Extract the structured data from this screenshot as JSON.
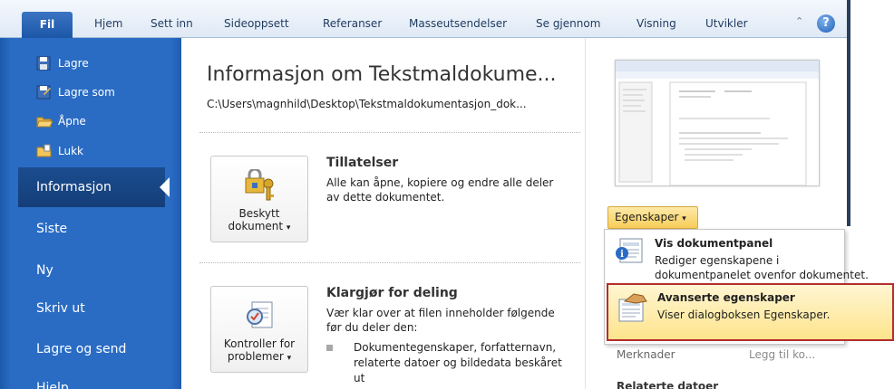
{
  "ribbon": {
    "file_tab": "Fil",
    "tabs": [
      "Hjem",
      "Sett inn",
      "Sideoppsett",
      "Referanser",
      "Masseutsendelser",
      "Se gjennom",
      "Visning",
      "Utvikler"
    ],
    "help_glyph": "?",
    "collapse_glyph": "⌃"
  },
  "nav": {
    "commands": [
      {
        "label": "Lagre",
        "icon": "save-icon"
      },
      {
        "label": "Lagre som",
        "icon": "save-as-icon"
      },
      {
        "label": "Åpne",
        "icon": "open-folder-icon"
      },
      {
        "label": "Lukk",
        "icon": "close-folder-icon"
      }
    ],
    "items": [
      "Informasjon",
      "Siste",
      "Ny",
      "Skriv ut",
      "Lagre og send",
      "Hjelp"
    ],
    "selected": "Informasjon"
  },
  "main": {
    "title": "Informasjon om Tekstmaldokume...",
    "path": "C:\\Users\\magnhild\\Desktop\\Tekstmaldokumentasjon_dok...",
    "permissions": {
      "button_label_1": "Beskytt",
      "button_label_2": "dokument",
      "dropdown_arrow": "▾",
      "title": "Tillatelser",
      "description": "Alle kan åpne, kopiere og endre alle deler av dette dokumentet."
    },
    "prepare": {
      "button_label_1": "Kontroller for",
      "button_label_2": "problemer",
      "dropdown_arrow": "▾",
      "title": "Klargjør for deling",
      "description": "Vær klar over at filen inneholder følgende før du deler den:",
      "bullets": [
        "Dokumentegenskaper, forfatternavn, relaterte datoer og bildedata beskåret ut"
      ]
    }
  },
  "properties": {
    "button_label": "Egenskaper",
    "button_arrow": "▾",
    "menu": [
      {
        "title": "Vis dokumentpanel",
        "desc_1": "Rediger egenskapene i",
        "desc_2": "dokumentpanelet ovenfor dokumentet.",
        "icon": "document-panel-icon"
      },
      {
        "title": "Avanserte egenskaper",
        "desc_1": "Viser dialogboksen Egenskaper.",
        "icon": "advanced-properties-icon"
      }
    ],
    "meta": {
      "label": "Merknader",
      "value": "Legg til ko..."
    },
    "cut_label": "Relaterte datoer"
  },
  "colors": {
    "accent": "#2a6cc4",
    "highlight_border": "#b52d2d",
    "highlight_fill": "#fde48c"
  }
}
